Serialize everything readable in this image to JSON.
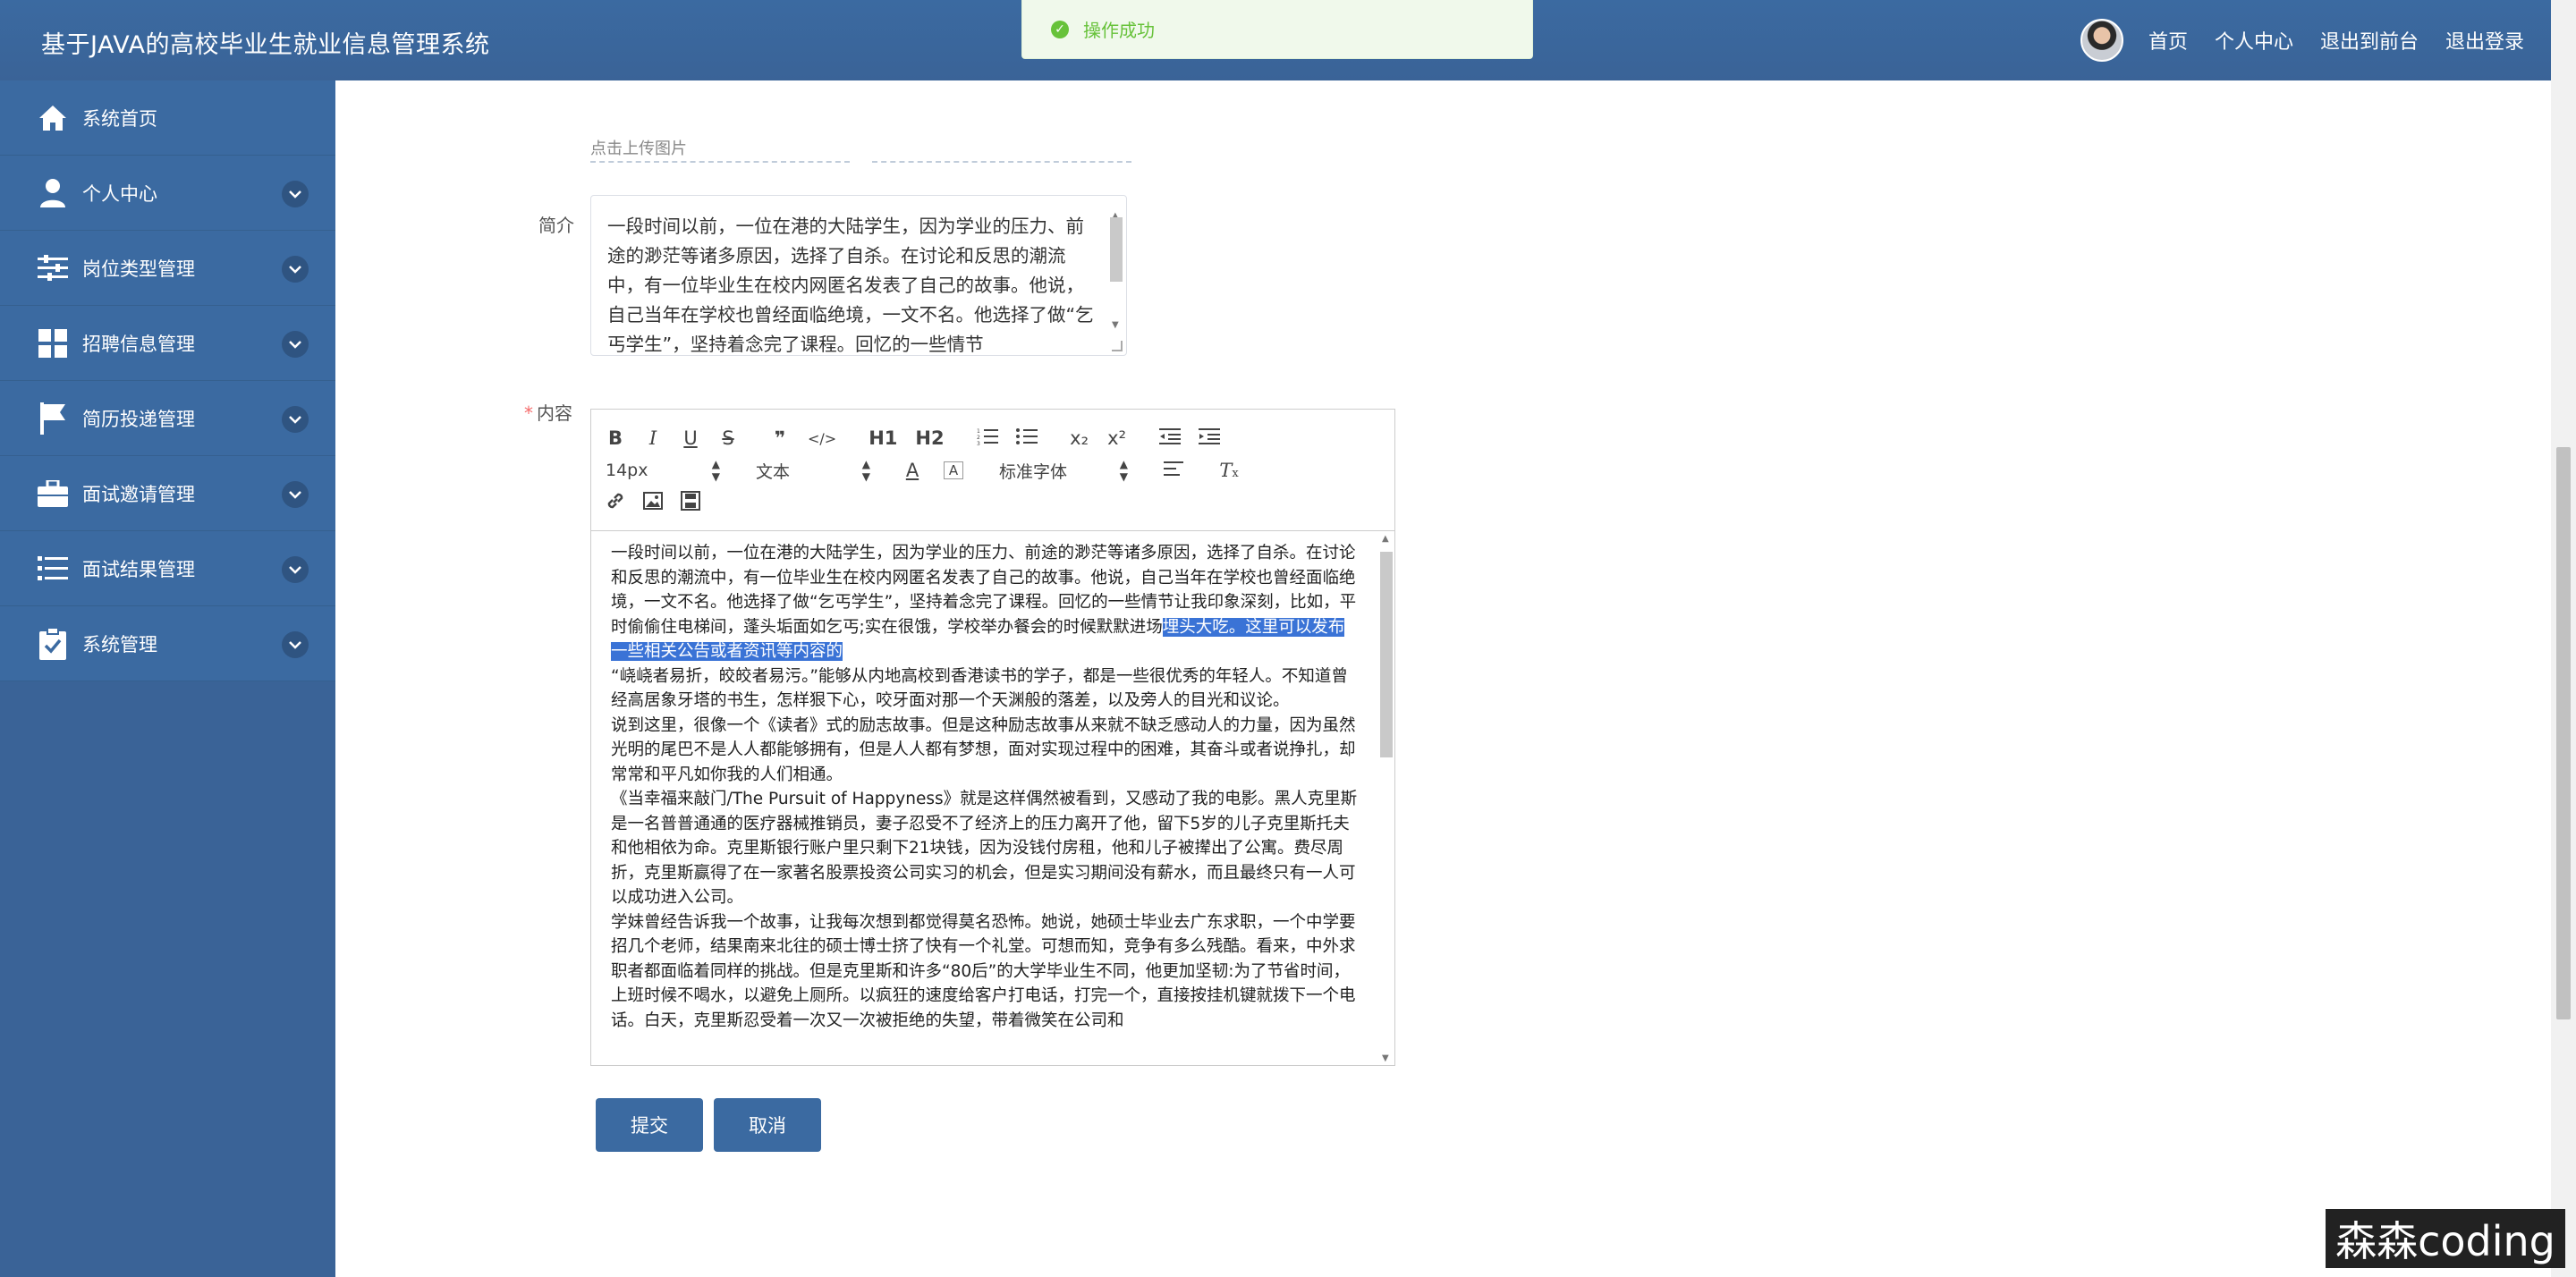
{
  "header": {
    "title": "基于JAVA的高校毕业生就业信息管理系统",
    "nav": [
      "首页",
      "个人中心",
      "退出到前台",
      "退出登录"
    ]
  },
  "toast": {
    "icon": "check-circle-icon",
    "message": "操作成功"
  },
  "sidebar": {
    "items": [
      {
        "label": "系统首页",
        "icon": "home-icon",
        "expandable": false
      },
      {
        "label": "个人中心",
        "icon": "user-icon",
        "expandable": true
      },
      {
        "label": "岗位类型管理",
        "icon": "sliders-icon",
        "expandable": true
      },
      {
        "label": "招聘信息管理",
        "icon": "grid-icon",
        "expandable": true
      },
      {
        "label": "简历投递管理",
        "icon": "flag-icon",
        "expandable": true
      },
      {
        "label": "面试邀请管理",
        "icon": "briefcase-icon",
        "expandable": true
      },
      {
        "label": "面试结果管理",
        "icon": "list-icon",
        "expandable": true
      },
      {
        "label": "系统管理",
        "icon": "clipboard-check-icon",
        "expandable": true
      }
    ]
  },
  "form": {
    "upload_hint": "点击上传图片",
    "intro_label": "简介",
    "intro_text": "一段时间以前，一位在港的大陆学生，因为学业的压力、前途的渺茫等诸多原因，选择了自杀。在讨论和反思的潮流中，有一位毕业生在校内网匿名发表了自己的故事。他说，自己当年在学校也曾经面临绝境，一文不名。他选择了做“乞丐学生”，坚持着念完了课程。回忆的一些情节",
    "content_label": "内容",
    "required_mark": "*",
    "submit_label": "提交",
    "cancel_label": "取消"
  },
  "editor": {
    "toolbar_row1": [
      "B",
      "I",
      "U",
      "S",
      "❞",
      "</>",
      "H1",
      "H2",
      "ol",
      "ul",
      "x₂",
      "x²",
      "outdent",
      "indent"
    ],
    "font_size": "14px",
    "text_type": "文本",
    "font_family": "标准字体",
    "paragraphs": [
      {
        "text": "一段时间以前，一位在港的大陆学生，因为学业的压力、前途的渺茫等诸多原因，选择了自杀。在讨论和反思的潮流中，有一位毕业生在校内网匿名发表了自己的故事。他说，自己当年在学校也曾经面临绝境，一文不名。他选择了做“乞丐学生”，坚持着念完了课程。回忆的一些情节让我印象深刻，比如，平时偷偷住电梯间，蓬头垢面如乞丐;实在很饿，学校举办餐会的时候默默进场",
        "highlight": "埋头大吃。这里可以发布一些相关公告或者资讯等内容的"
      },
      {
        "text": "“峣峣者易折，皎皎者易污。”能够从内地高校到香港读书的学子，都是一些很优秀的年轻人。不知道曾经高居象牙塔的书生，怎样狠下心，咬牙面对那一个天渊般的落差，以及旁人的目光和议论。",
        "highlight": ""
      },
      {
        "text": "说到这里，很像一个《读者》式的励志故事。但是这种励志故事从来就不缺乏感动人的力量，因为虽然光明的尾巴不是人人都能够拥有，但是人人都有梦想，面对实现过程中的困难，其奋斗或者说挣扎，却常常和平凡如你我的人们相通。",
        "highlight": ""
      },
      {
        "text": "《当幸福来敲门/The Pursuit of Happyness》就是这样偶然被看到，又感动了我的电影。黑人克里斯是一名普普通通的医疗器械推销员，妻子忍受不了经济上的压力离开了他，留下5岁的儿子克里斯托夫和他相依为命。克里斯银行账户里只剩下21块钱，因为没钱付房租，他和儿子被撵出了公寓。费尽周折，克里斯赢得了在一家著名股票投资公司实习的机会，但是实习期间没有薪水，而且最终只有一人可以成功进入公司。",
        "highlight": ""
      },
      {
        "text": "学妹曾经告诉我一个故事，让我每次想到都觉得莫名恐怖。她说，她硕士毕业去广东求职，一个中学要招几个老师，结果南来北往的硕士博士挤了快有一个礼堂。可想而知，竞争有多么残酷。看来，中外求职者都面临着同样的挑战。但是克里斯和许多“80后”的大学毕业生不同，他更加坚韧:为了节省时间，上班时候不喝水，以避免上厕所。以疯狂的速度给客户打电话，打完一个，直接按挂机键就拨下一个电话。白天，克里斯忍受着一次又一次被拒绝的失望，带着微笑在公司和",
        "highlight": ""
      }
    ]
  },
  "watermark": "森森coding"
}
